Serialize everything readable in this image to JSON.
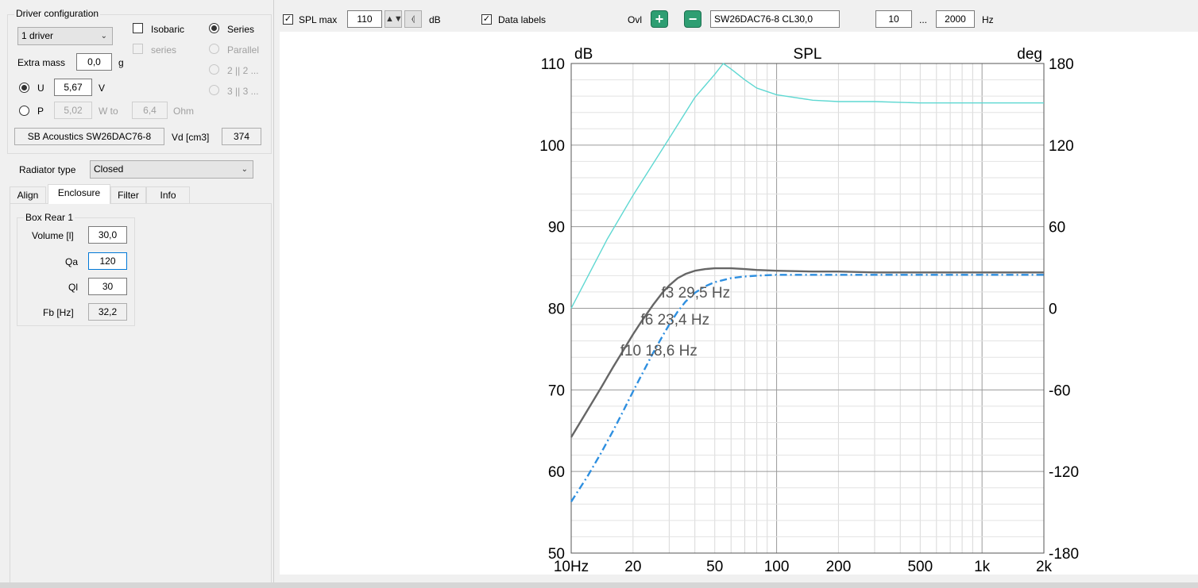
{
  "driver_config": {
    "title": "Driver configuration",
    "driver_count": "1 driver",
    "isobaric_label": "Isobaric",
    "series_sub_label": "series",
    "series_label": "Series",
    "parallel_label": "Parallel",
    "opt_2x2": "2 || 2 ...",
    "opt_3x3": "3 || 3 ...",
    "extra_mass_label": "Extra mass",
    "extra_mass_value": "0,0",
    "extra_mass_unit": "g",
    "u_label": "U",
    "u_value": "5,67",
    "u_unit": "V",
    "p_label": "P",
    "p_value": "5,02",
    "p_unit": "W to",
    "ohm_value": "6,4",
    "ohm_unit": "Ohm",
    "driver_name": "SB Acoustics SW26DAC76-8",
    "vd_label": "Vd [cm3]",
    "vd_value": "374"
  },
  "radiator": {
    "label": "Radiator type",
    "value": "Closed"
  },
  "tabs": [
    "Align",
    "Enclosure",
    "Filter",
    "Info"
  ],
  "active_tab": "Enclosure",
  "box": {
    "title": "Box Rear 1",
    "volume_label": "Volume [l]",
    "volume_value": "30,0",
    "qa_label": "Qa",
    "qa_value": "120",
    "ql_label": "Ql",
    "ql_value": "30",
    "fb_label": "Fb [Hz]",
    "fb_value": "32,2"
  },
  "toolbar": {
    "spl_max_label": "SPL max",
    "spl_max_value": "110",
    "spl_unit": "dB",
    "data_labels_label": "Data labels",
    "ovl_label": "Ovl",
    "overlay_name": "SW26DAC76-8 CL30,0",
    "freq_min": "10",
    "freq_sep": "...",
    "freq_max": "2000",
    "freq_unit": "Hz"
  },
  "chart_data": {
    "type": "line",
    "title": "SPL",
    "ylabel": "dB",
    "y2label": "deg",
    "xscale": "log",
    "xlim": [
      10,
      2000
    ],
    "ylim": [
      50,
      110
    ],
    "y2lim": [
      -180,
      180
    ],
    "xticks": [
      10,
      20,
      50,
      100,
      200,
      500,
      1000,
      2000
    ],
    "xtick_labels": [
      "10Hz",
      "20",
      "50",
      "100",
      "200",
      "500",
      "1k",
      "2k"
    ],
    "yticks": [
      50,
      60,
      70,
      80,
      90,
      100,
      110
    ],
    "y2ticks": [
      -180,
      -120,
      -60,
      0,
      60,
      120,
      180
    ],
    "grid": true,
    "series": [
      {
        "axis": "left",
        "color": "#666666",
        "style": "solid",
        "x": [
          10,
          12,
          14,
          16,
          18,
          20,
          22,
          25,
          28,
          30,
          33,
          36,
          40,
          45,
          50,
          60,
          70,
          80,
          100,
          150,
          200,
          300,
          500,
          1000,
          2000
        ],
        "y": [
          64.2,
          67.5,
          70.3,
          72.8,
          74.9,
          76.8,
          78.4,
          80.4,
          82.0,
          82.8,
          83.7,
          84.2,
          84.6,
          84.8,
          84.9,
          84.9,
          84.8,
          84.7,
          84.6,
          84.5,
          84.5,
          84.4,
          84.4,
          84.4,
          84.4
        ]
      },
      {
        "axis": "left",
        "color": "#2e8fe0",
        "style": "dashdot",
        "x": [
          10,
          12,
          14,
          16,
          18,
          20,
          22,
          25,
          28,
          30,
          33,
          36,
          40,
          45,
          50,
          60,
          70,
          80,
          100,
          150,
          200,
          300,
          500,
          1000,
          2000
        ],
        "y": [
          56.3,
          59.4,
          62.3,
          65.0,
          67.5,
          69.8,
          71.8,
          74.5,
          76.7,
          78.0,
          79.6,
          80.8,
          81.9,
          82.7,
          83.2,
          83.7,
          83.9,
          84.0,
          84.1,
          84.1,
          84.1,
          84.1,
          84.1,
          84.1,
          84.1
        ]
      },
      {
        "axis": "right",
        "color": "#5fd8d2",
        "style": "solid",
        "x": [
          10,
          15,
          20,
          30,
          40,
          50,
          55,
          60,
          70,
          80,
          100,
          150,
          200,
          300,
          500,
          1000,
          2000
        ],
        "y": [
          0,
          51,
          83,
          125,
          155,
          172,
          180,
          176,
          168,
          162,
          157,
          153,
          152,
          152,
          151,
          151,
          151
        ]
      }
    ],
    "annotations": [
      {
        "text": "f3 29,5 Hz",
        "x": 29.5,
        "y": 82.0
      },
      {
        "text": "f6 23,4 Hz",
        "x": 23.4,
        "y": 78.7
      },
      {
        "text": "f10 18,6 Hz",
        "x": 18.6,
        "y": 74.9
      }
    ]
  }
}
